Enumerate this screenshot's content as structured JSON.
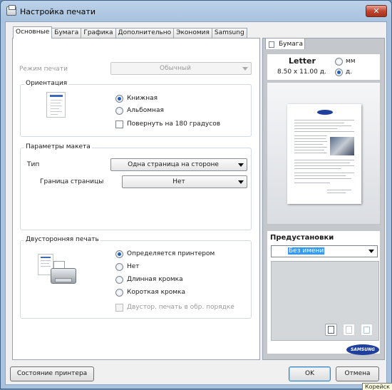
{
  "window": {
    "title": "Настройка печати",
    "close_label": "✕"
  },
  "tabs": [
    "Основные",
    "Бумага",
    "Графика",
    "Дополнительно",
    "Экономия",
    "Samsung"
  ],
  "print_mode": {
    "label": "Режим печати",
    "value": "Обычный"
  },
  "orientation": {
    "title": "Ориентация",
    "options": [
      {
        "label": "Книжная",
        "selected": true
      },
      {
        "label": "Альбомная",
        "selected": false
      }
    ],
    "rotate_label": "Повернуть на 180 градусов"
  },
  "layout": {
    "title": "Параметры макета",
    "type_label": "Тип",
    "type_value": "Одна страница на стороне",
    "border_label": "Граница страницы",
    "border_value": "Нет"
  },
  "duplex": {
    "title": "Двусторонняя печать",
    "options": [
      {
        "label": "Определяется принтером",
        "selected": true
      },
      {
        "label": "Нет",
        "selected": false
      },
      {
        "label": "Длинная кромка",
        "selected": false
      },
      {
        "label": "Короткая кромка",
        "selected": false
      }
    ],
    "reverse_label": "Двустор. печать в обр. порядке"
  },
  "preview": {
    "tab_label": "Бумага",
    "paper_name": "Letter",
    "paper_size": "8.50 x 11.00 д.",
    "units": [
      {
        "label": "мм",
        "selected": false
      },
      {
        "label": "д.",
        "selected": true
      }
    ],
    "brand": "SAMSUNG"
  },
  "presets": {
    "title": "Предустановки",
    "value": "Без имени"
  },
  "buttons": {
    "printer_status": "Состояние принтера",
    "ok": "OK",
    "cancel": "Отмена"
  },
  "tooltip": "Корейск"
}
